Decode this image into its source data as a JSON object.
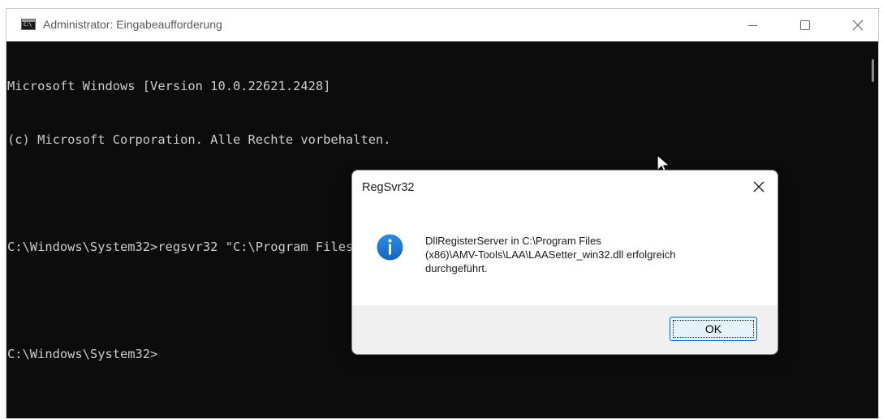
{
  "window": {
    "title": "Administrator: Eingabeaufforderung",
    "icon_text": "C:\\",
    "icon": "cmd-icon",
    "controls": [
      "minimize-icon",
      "maximize-icon",
      "close-icon"
    ]
  },
  "console": {
    "lines": [
      "Microsoft Windows [Version 10.0.22621.2428]",
      "(c) Microsoft Corporation. Alle Rechte vorbehalten.",
      "",
      "C:\\Windows\\System32>regsvr32 \"C:\\Program Files (x86)\\AMV-Tools\\LAA\\LAASetter_win32.dll\"",
      "",
      "C:\\Windows\\System32>"
    ]
  },
  "dialog": {
    "title": "RegSvr32",
    "icon": "info-icon",
    "message_lines": [
      "DllRegisterServer in C:\\Program Files",
      "(x86)\\AMV-Tools\\LAA\\LAASetter_win32.dll erfolgreich",
      "durchgeführt."
    ],
    "ok_label": "OK"
  },
  "colors": {
    "console_bg": "#0c0c0c",
    "console_text": "#cccccc",
    "info_blue": "#1a73d0",
    "ok_border": "#0067c0"
  }
}
